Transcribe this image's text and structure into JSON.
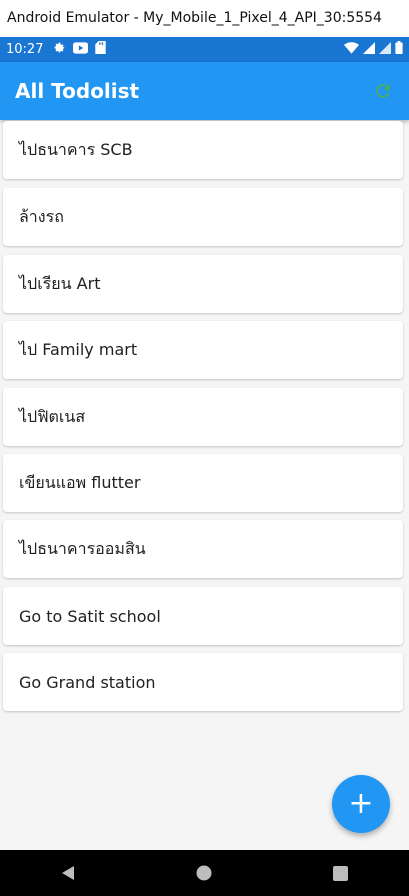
{
  "window": {
    "title": "Android Emulator - My_Mobile_1_Pixel_4_API_30:5554"
  },
  "status_bar": {
    "time": "10:27",
    "left_icons": [
      "gear-icon",
      "youtube-icon",
      "sd-card-icon"
    ],
    "right_icons": [
      "wifi-icon",
      "signal-icon",
      "signal-icon",
      "battery-icon"
    ]
  },
  "app_bar": {
    "title": "All Todolist",
    "action_icon": "refresh-icon",
    "action_color": "#4caf50",
    "color": "#2196f3"
  },
  "todos": [
    "ไปธนาคาร SCB",
    "ล้างรถ",
    "ไปเรียน Art",
    "ไป Family mart",
    "ไปฟิตเนส",
    "เขียนแอพ flutter",
    "ไปธนาคารออมสิน",
    "Go to Satit school",
    "Go Grand station"
  ],
  "fab": {
    "label": "+",
    "icon": "add-icon"
  },
  "nav_bar": {
    "buttons": [
      "back-icon",
      "home-icon",
      "recents-icon"
    ]
  }
}
